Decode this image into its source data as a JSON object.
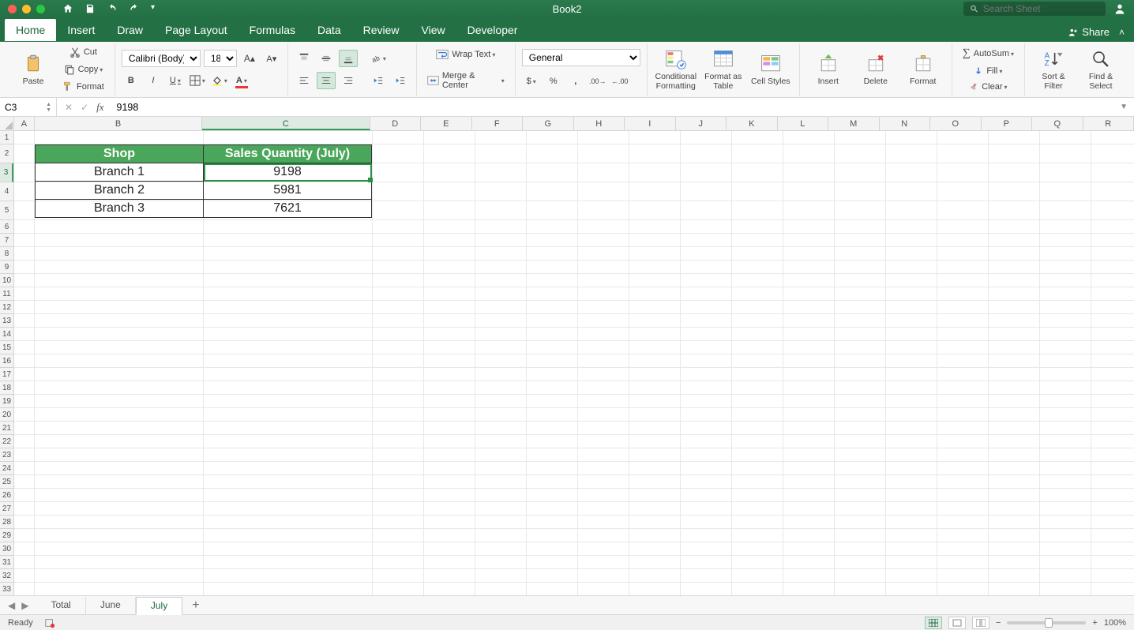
{
  "window": {
    "title": "Book2",
    "search_placeholder": "Search Sheet"
  },
  "tabs": {
    "items": [
      "Home",
      "Insert",
      "Draw",
      "Page Layout",
      "Formulas",
      "Data",
      "Review",
      "View",
      "Developer"
    ],
    "active": 0,
    "share": "Share"
  },
  "ribbon": {
    "paste": "Paste",
    "cut": "Cut",
    "copy": "Copy",
    "format_painter": "Format",
    "font_name": "Calibri (Body)",
    "font_size": "18",
    "bold": "B",
    "italic": "I",
    "underline": "U",
    "wrap": "Wrap Text",
    "merge": "Merge & Center",
    "number_format": "General",
    "cond_fmt": "Conditional Formatting",
    "fmt_table": "Format as Table",
    "cell_styles": "Cell Styles",
    "insert": "Insert",
    "delete": "Delete",
    "format": "Format",
    "autosum": "AutoSum",
    "fill": "Fill",
    "clear": "Clear",
    "sort": "Sort & Filter",
    "find": "Find & Select"
  },
  "formula": {
    "cell_ref": "C3",
    "value": "9198"
  },
  "columns": {
    "letters": [
      "A",
      "B",
      "C",
      "D",
      "E",
      "F",
      "G",
      "H",
      "I",
      "J",
      "K",
      "L",
      "M",
      "N",
      "O",
      "P",
      "Q",
      "R"
    ],
    "widths": [
      26,
      214,
      214,
      65,
      65,
      65,
      65,
      65,
      65,
      65,
      65,
      65,
      65,
      65,
      65,
      65,
      65,
      65
    ],
    "active_index": 2
  },
  "rows": {
    "count": 34,
    "active": 3,
    "tall": [
      2,
      3,
      4,
      5
    ]
  },
  "table": {
    "headers": [
      "Shop",
      "Sales Quantity (July)"
    ],
    "rows": [
      [
        "Branch 1",
        "9198"
      ],
      [
        "Branch 2",
        "5981"
      ],
      [
        "Branch 3",
        "7621"
      ]
    ]
  },
  "selection": {
    "col_index": 2,
    "row": 3
  },
  "sheets": {
    "items": [
      "Total",
      "June",
      "July"
    ],
    "active": 2
  },
  "status": {
    "ready": "Ready",
    "zoom": "100%"
  }
}
